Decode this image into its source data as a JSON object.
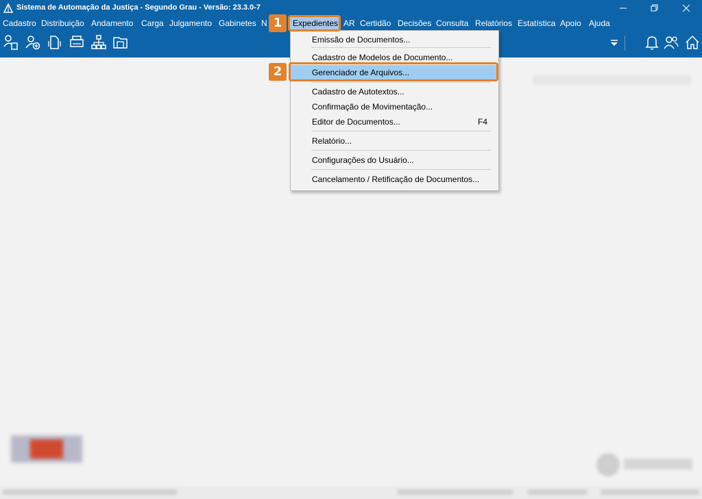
{
  "window": {
    "title": "Sistema de Automação da Justiça - Segundo Grau - Versão: 23.3.0-7",
    "minimize_icon": "minimize-icon",
    "restore_icon": "restore-icon",
    "close_icon": "close-icon"
  },
  "menubar": {
    "items": [
      {
        "label": "Cadastro"
      },
      {
        "label": "Distribuição"
      },
      {
        "label": "Andamento"
      },
      {
        "label": "Carga"
      },
      {
        "label": "Julgamento"
      },
      {
        "label": "Gabinetes"
      },
      {
        "label": "N"
      },
      {
        "label": "Expedientes"
      },
      {
        "label": "AR"
      },
      {
        "label": "Certidão"
      },
      {
        "label": "Decisões"
      },
      {
        "label": "Consulta"
      },
      {
        "label": "Relatórios"
      },
      {
        "label": "Estatística"
      },
      {
        "label": "Apoio"
      },
      {
        "label": "Ajuda"
      }
    ]
  },
  "toolbar": {
    "icons": [
      "user-document-icon",
      "add-user-icon",
      "document-arrows-icon",
      "printer-icon",
      "hierarchy-icon",
      "folder-icon"
    ],
    "right_icons": [
      "dropdown-arrow-icon",
      "bell-icon",
      "users-icon",
      "home-icon"
    ]
  },
  "expedientes_menu": {
    "items": [
      {
        "label": "Emissão de Documentos...",
        "shortcut": ""
      },
      {
        "label": "Cadastro de Modelos de Documento...",
        "shortcut": ""
      },
      {
        "label": "Gerenciador de Arquivos...",
        "shortcut": ""
      },
      {
        "label": "Cadastro de Autotextos...",
        "shortcut": ""
      },
      {
        "label": "Confirmação de Movimentação...",
        "shortcut": ""
      },
      {
        "label": "Editor de Documentos...",
        "shortcut": "F4"
      },
      {
        "label": "Relatório...",
        "shortcut": ""
      },
      {
        "label": "Configurações do Usuário...",
        "shortcut": ""
      },
      {
        "label": "Cancelamento / Retificação de Documentos...",
        "shortcut": ""
      }
    ]
  },
  "annotations": {
    "step1": "1",
    "step2": "2",
    "accent_color": "#e2822c"
  },
  "colors": {
    "titlebar": "#0e64a8",
    "highlight": "#9fcdf2",
    "background": "#f2f2f2"
  }
}
